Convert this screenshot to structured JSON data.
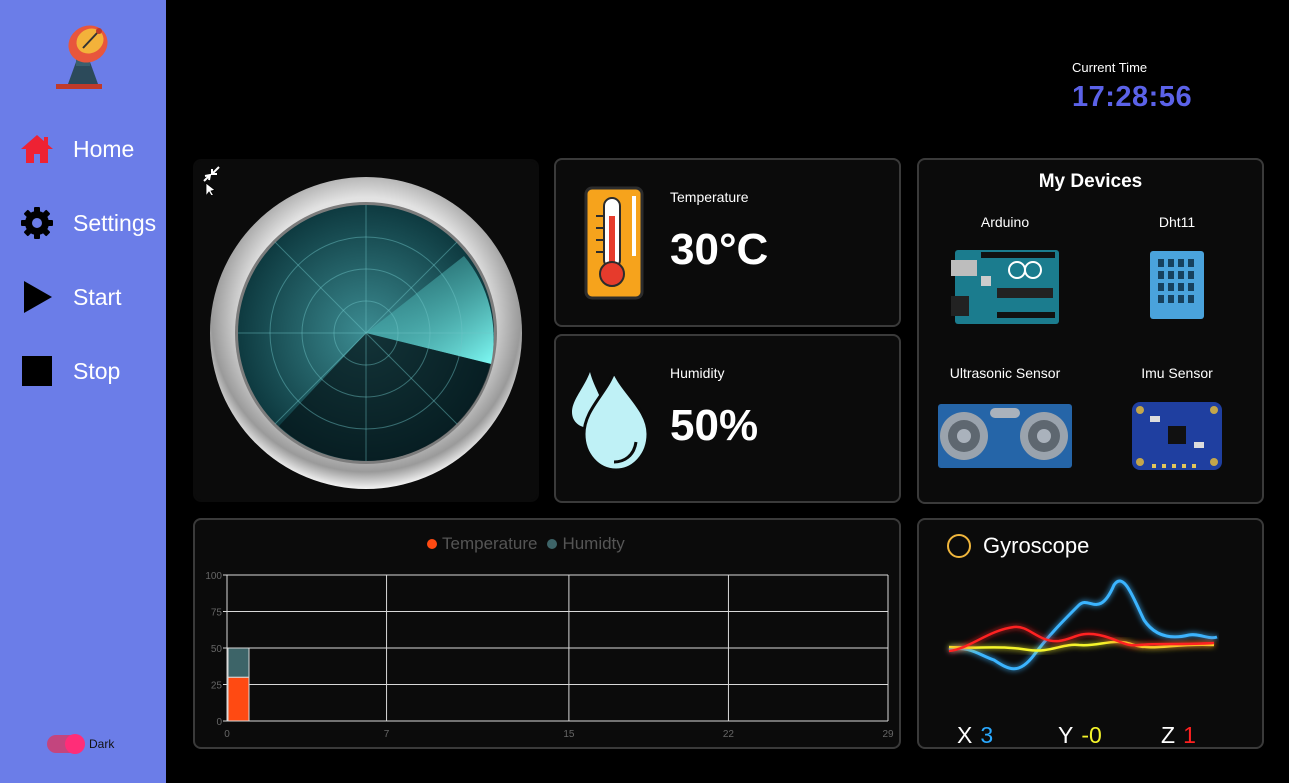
{
  "sidebar": {
    "nav": [
      {
        "label": "Home",
        "icon": "home-icon",
        "color": "#ee2233"
      },
      {
        "label": "Settings",
        "icon": "gear-icon",
        "color": "#000000"
      },
      {
        "label": "Start",
        "icon": "play-icon",
        "color": "#000000"
      },
      {
        "label": "Stop",
        "icon": "stop-icon",
        "color": "#000000"
      }
    ],
    "theme_label": "Dark"
  },
  "clock": {
    "label": "Current Time",
    "value": "17:28:56"
  },
  "temperature": {
    "label": "Temperature",
    "value": "30°C"
  },
  "humidity": {
    "label": "Humidity",
    "value": "50%"
  },
  "devices": {
    "title": "My Devices",
    "items": [
      {
        "label": "Arduino",
        "icon": "arduino-board-icon"
      },
      {
        "label": "Dht11",
        "icon": "dht11-sensor-icon"
      },
      {
        "label": "Ultrasonic Sensor",
        "icon": "ultrasonic-sensor-icon"
      },
      {
        "label": "Imu Sensor",
        "icon": "imu-sensor-icon"
      }
    ]
  },
  "gyroscope": {
    "title": "Gyroscope",
    "x_label": "X",
    "x_value": "3",
    "y_label": "Y",
    "y_value": "-0",
    "z_label": "Z",
    "z_value": "1",
    "colors": {
      "x": "#2aa9ff",
      "y": "#f5f52a",
      "z": "#ff2020"
    }
  },
  "chart_data": {
    "type": "bar",
    "stacked": true,
    "categories": [
      "0"
    ],
    "series": [
      {
        "name": "Temperature",
        "values": [
          30
        ],
        "color": "#ff4a12"
      },
      {
        "name": "Humidty",
        "values": [
          20
        ],
        "color": "#3d6468"
      }
    ],
    "xlim": [
      0,
      29
    ],
    "xticks": [
      "0",
      "7",
      "15",
      "22",
      "29"
    ],
    "ylim": [
      0,
      100
    ],
    "yticks": [
      "0",
      "25",
      "50",
      "75",
      "100"
    ],
    "grid": true,
    "legend": "top-center"
  }
}
